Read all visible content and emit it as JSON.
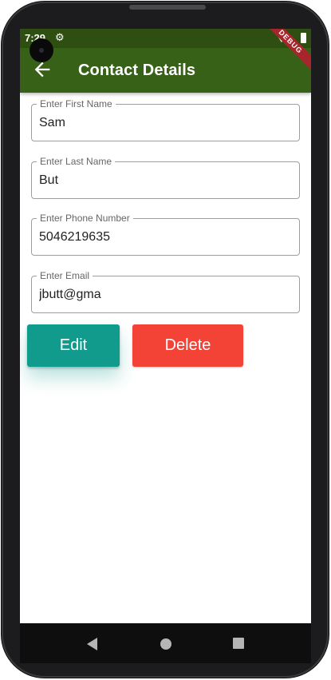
{
  "status_bar": {
    "time": "7:29",
    "settings_icon": "gear-icon",
    "wifi_icon": "wifi-icon",
    "battery_icon": "battery-icon"
  },
  "app_bar": {
    "title": "Contact Details",
    "back_icon": "arrow-left-icon",
    "background": "#386118",
    "status_background": "#2f4f12"
  },
  "debug_banner": "DEBUG",
  "form": {
    "fields": [
      {
        "label": "Enter First Name",
        "value": "Sam"
      },
      {
        "label": "Enter Last Name",
        "value": "But"
      },
      {
        "label": "Enter Phone Number",
        "value": "5046219635"
      },
      {
        "label": "Enter Email",
        "value": "jbutt@gma"
      }
    ]
  },
  "actions": {
    "edit_label": "Edit",
    "delete_label": "Delete",
    "edit_color": "#119b8c",
    "delete_color": "#f34336"
  },
  "navigation": {
    "back_icon": "triangle-back-icon",
    "home_icon": "circle-home-icon",
    "recents_icon": "square-recents-icon"
  }
}
